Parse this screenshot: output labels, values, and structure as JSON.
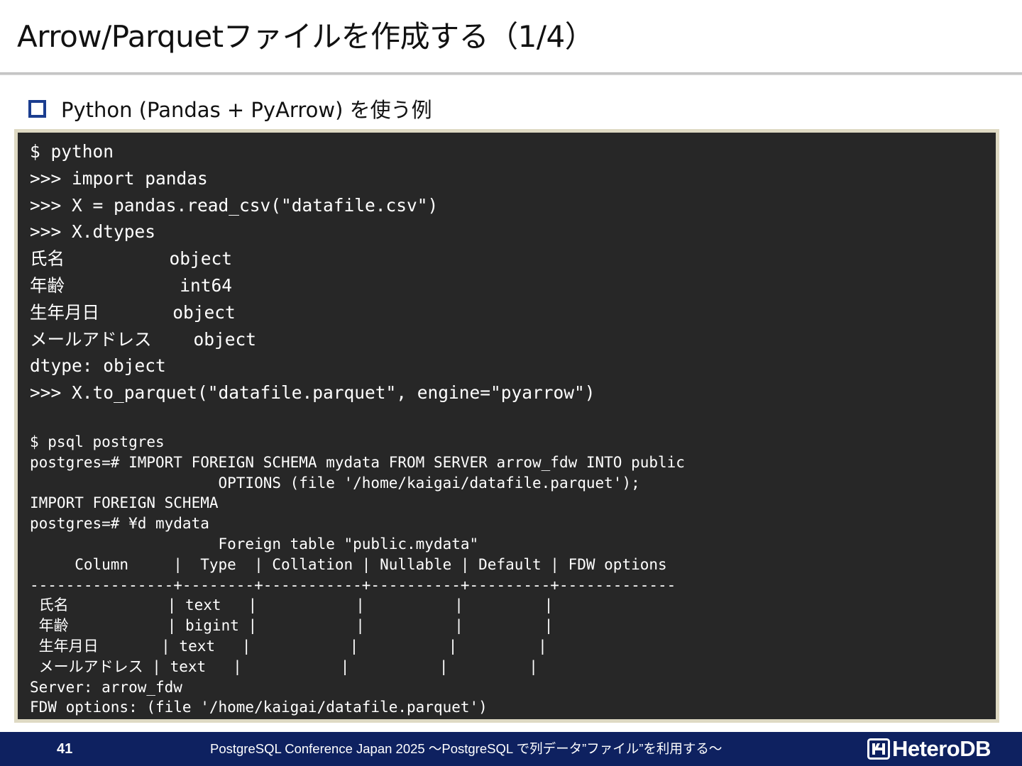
{
  "slide": {
    "title": "Arrow/Parquetファイルを作成する（1/4）",
    "bullet": "Python (Pandas + PyArrow) を使う例"
  },
  "code": {
    "python_lines": [
      "$ python",
      ">>> import pandas",
      ">>> X = pandas.read_csv(\"datafile.csv\")",
      ">>> X.dtypes",
      "氏名          object",
      "年齢           int64",
      "生年月日       object",
      "メールアドレス    object",
      "dtype: object",
      ">>> X.to_parquet(\"datafile.parquet\", engine=\"pyarrow\")"
    ],
    "psql_lines": [
      "$ psql postgres",
      "postgres=# IMPORT FOREIGN SCHEMA mydata FROM SERVER arrow_fdw INTO public",
      "                     OPTIONS (file '/home/kaigai/datafile.parquet');",
      "IMPORT FOREIGN SCHEMA",
      "postgres=# ¥d mydata",
      "                     Foreign table \"public.mydata\"",
      "     Column     |  Type  | Collation | Nullable | Default | FDW options",
      "----------------+--------+-----------+----------+---------+-------------",
      " 氏名           | text   |           |          |         |",
      " 年齢           | bigint |           |          |         |",
      " 生年月日       | text   |           |          |         |",
      " メールアドレス | text   |           |          |         |",
      "Server: arrow_fdw",
      "FDW options: (file '/home/kaigai/datafile.parquet')"
    ]
  },
  "footer": {
    "page_number": "41",
    "conference": "PostgreSQL Conference Japan 2025 ～PostgreSQL で列データ”ファイル”を利用する～",
    "logo_text": "HeteroDB"
  },
  "colors": {
    "footer_bg": "#0e2160",
    "code_bg": "#272727",
    "code_border": "#ded9c3",
    "bullet": "#1b3d8f"
  }
}
